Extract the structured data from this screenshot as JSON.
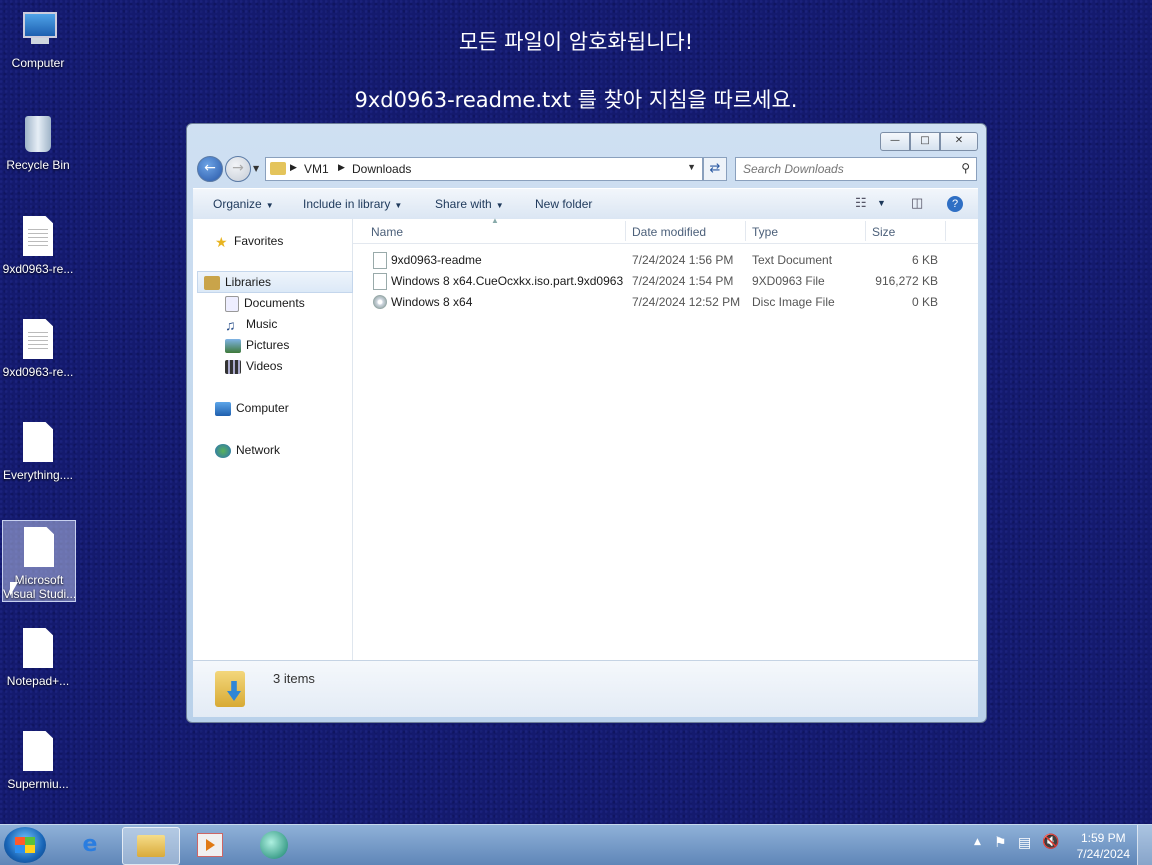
{
  "ransom_note": {
    "line1": "모든 파일이 암호화됩니다!",
    "line2": "9xd0963-readme.txt 를 찾아 지침을 따르세요."
  },
  "desktop_icons": [
    {
      "label": "Computer",
      "icon": "computer-icon"
    },
    {
      "label": "Recycle Bin",
      "icon": "recycle-bin-icon"
    },
    {
      "label": "9xd0963-re...",
      "icon": "text-file-icon"
    },
    {
      "label": "9xd0963-re...",
      "icon": "text-file-icon"
    },
    {
      "label": "Everything....",
      "icon": "file-icon"
    },
    {
      "label_line1": "Microsoft",
      "label_line2": "Visual Studi...",
      "icon": "file-icon",
      "selected": true
    },
    {
      "label": "Notepad+...",
      "icon": "file-icon"
    },
    {
      "label": "Supermiu...",
      "icon": "file-icon"
    }
  ],
  "explorer": {
    "address": {
      "crumb1": "VM1",
      "crumb2": "Downloads"
    },
    "search_placeholder": "Search Downloads",
    "commands": {
      "organize": "Organize",
      "include": "Include in library",
      "share": "Share with",
      "new_folder": "New folder"
    },
    "nav": {
      "favorites": "Favorites",
      "libraries": "Libraries",
      "documents": "Documents",
      "music": "Music",
      "pictures": "Pictures",
      "videos": "Videos",
      "computer": "Computer",
      "network": "Network"
    },
    "columns": {
      "name": "Name",
      "date": "Date modified",
      "type": "Type",
      "size": "Size"
    },
    "files": [
      {
        "name": "9xd0963-readme",
        "date": "7/24/2024 1:56 PM",
        "type": "Text Document",
        "size": "6 KB",
        "icon": "text-file-icon"
      },
      {
        "name": "Windows 8 x64.CueOcxkx.iso.part.9xd0963",
        "date": "7/24/2024 1:54 PM",
        "type": "9XD0963 File",
        "size": "916,272 KB",
        "icon": "file-icon"
      },
      {
        "name": "Windows 8 x64",
        "date": "7/24/2024 12:52 PM",
        "type": "Disc Image File",
        "size": "0 KB",
        "icon": "disc-image-icon"
      }
    ],
    "status": "3 items"
  },
  "taskbar": {
    "clock_time": "1:59 PM",
    "clock_date": "7/24/2024"
  }
}
